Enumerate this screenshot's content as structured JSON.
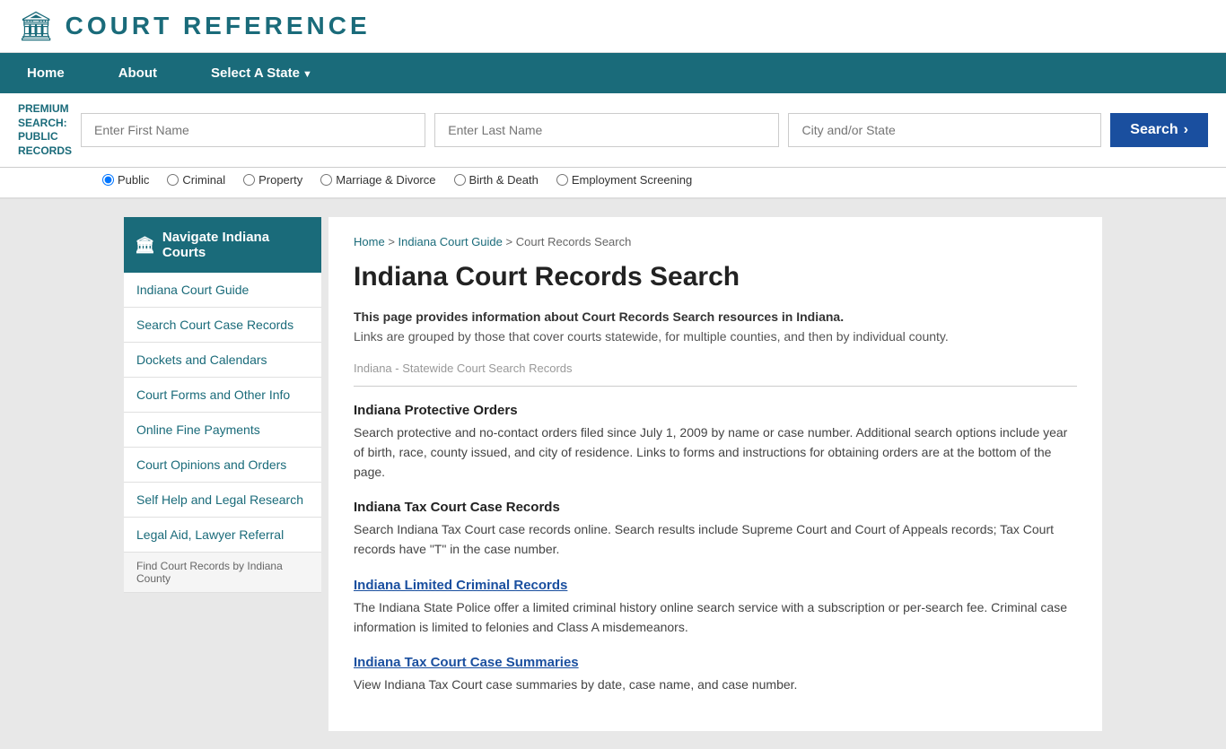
{
  "header": {
    "logo_icon": "🏛",
    "logo_text": "COURT REFERENCE"
  },
  "nav": {
    "items": [
      {
        "label": "Home",
        "has_arrow": false
      },
      {
        "label": "About",
        "has_arrow": false
      },
      {
        "label": "Select A State",
        "has_arrow": true
      }
    ]
  },
  "search_bar": {
    "label_line1": "PREMIUM",
    "label_line2": "SEARCH:",
    "label_line3": "PUBLIC",
    "label_line4": "RECORDS",
    "first_name_placeholder": "Enter First Name",
    "last_name_placeholder": "Enter Last Name",
    "city_placeholder": "City and/or State",
    "button_label": "Search",
    "button_arrow": "›"
  },
  "radio_options": [
    {
      "label": "Public",
      "checked": true
    },
    {
      "label": "Criminal",
      "checked": false
    },
    {
      "label": "Property",
      "checked": false
    },
    {
      "label": "Marriage & Divorce",
      "checked": false
    },
    {
      "label": "Birth & Death",
      "checked": false
    },
    {
      "label": "Employment Screening",
      "checked": false
    }
  ],
  "breadcrumb": {
    "home": "Home",
    "state_guide": "Indiana Court Guide",
    "current": "Court Records Search"
  },
  "page_title": "Indiana Court Records Search",
  "intro": {
    "bold": "This page provides information about Court Records Search resources in Indiana.",
    "normal": "Links are grouped by those that cover courts statewide, for multiple counties, and then by individual county."
  },
  "statewide_section_label": "Indiana - Statewide Court Search Records",
  "records": [
    {
      "title": "Indiana Protective Orders",
      "title_link": false,
      "body": "Search protective and no-contact orders filed since July 1, 2009 by name or case number. Additional search options include year of birth, race, county issued, and city of residence. Links to forms and instructions for obtaining orders are at the bottom of the page."
    },
    {
      "title": "Indiana Tax Court Case Records",
      "title_link": false,
      "body": "Search Indiana Tax Court case records online. Search results include Supreme Court and Court of Appeals records; Tax Court records have \"T\" in the case number."
    },
    {
      "title": "Indiana Limited Criminal Records",
      "title_link": true,
      "body": "The Indiana State Police offer a limited criminal history online search service with a subscription or per-search fee. Criminal case information is limited to felonies and Class A misdemeanors."
    },
    {
      "title": "Indiana Tax Court Case Summaries",
      "title_link": true,
      "body": "View Indiana Tax Court case summaries by date, case name, and case number."
    }
  ],
  "sidebar": {
    "nav_header": "Navigate Indiana Courts",
    "nav_icon": "🏛",
    "links": [
      {
        "label": "Indiana Court Guide"
      },
      {
        "label": "Search Court Case Records"
      },
      {
        "label": "Dockets and Calendars"
      },
      {
        "label": "Court Forms and Other Info"
      },
      {
        "label": "Online Fine Payments"
      },
      {
        "label": "Court Opinions and Orders"
      },
      {
        "label": "Self Help and Legal Research"
      },
      {
        "label": "Legal Aid, Lawyer Referral"
      }
    ],
    "section_label": "Find Court Records by Indiana County"
  }
}
